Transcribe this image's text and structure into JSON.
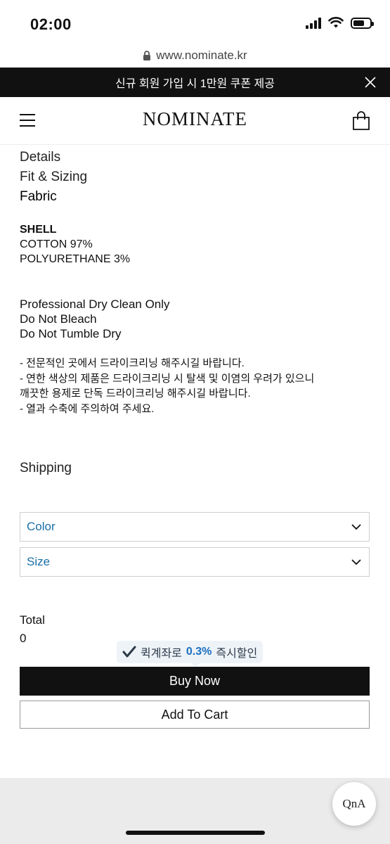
{
  "status_bar": {
    "time": "02:00"
  },
  "browser": {
    "url": "www.nominate.kr"
  },
  "promo": {
    "text": "신규 회원 가입 시 1만원 쿠폰 제공"
  },
  "header": {
    "brand": "NOMINATE"
  },
  "tabs": {
    "details": "Details",
    "fit": "Fit & Sizing",
    "fabric": "Fabric"
  },
  "fabric": {
    "heading": "SHELL",
    "lines": [
      "COTTON 97%",
      "POLYURETHANE 3%"
    ]
  },
  "care": {
    "lines": [
      "Professional Dry Clean Only",
      "Do Not Bleach",
      "Do Not Tumble Dry"
    ]
  },
  "notes": {
    "lines": [
      "- 전문적인 곳에서 드라이크리닝 해주시길 바랍니다.",
      "- 연한 색상의 제품은 드라이크리닝 시 탈색 및 이염의 우려가 있으니",
      "깨끗한 용제로 단독 드라이크리닝 해주시길 바랍니다.",
      "- 열과 수축에 주의하여 주세요."
    ]
  },
  "shipping": {
    "label": "Shipping"
  },
  "options": {
    "color": "Color",
    "size": "Size"
  },
  "total": {
    "label": "Total",
    "value": "0"
  },
  "discount": {
    "prefix": "퀵계좌로",
    "rate": "0.3%",
    "suffix": "즉시할인"
  },
  "actions": {
    "buy_now": "Buy Now",
    "add_to_cart": "Add To Cart"
  },
  "qna": {
    "label": "QnA"
  },
  "colors": {
    "accent": "#1a6fa8",
    "dark": "#111111",
    "discount_blue": "#1a6fc0"
  }
}
